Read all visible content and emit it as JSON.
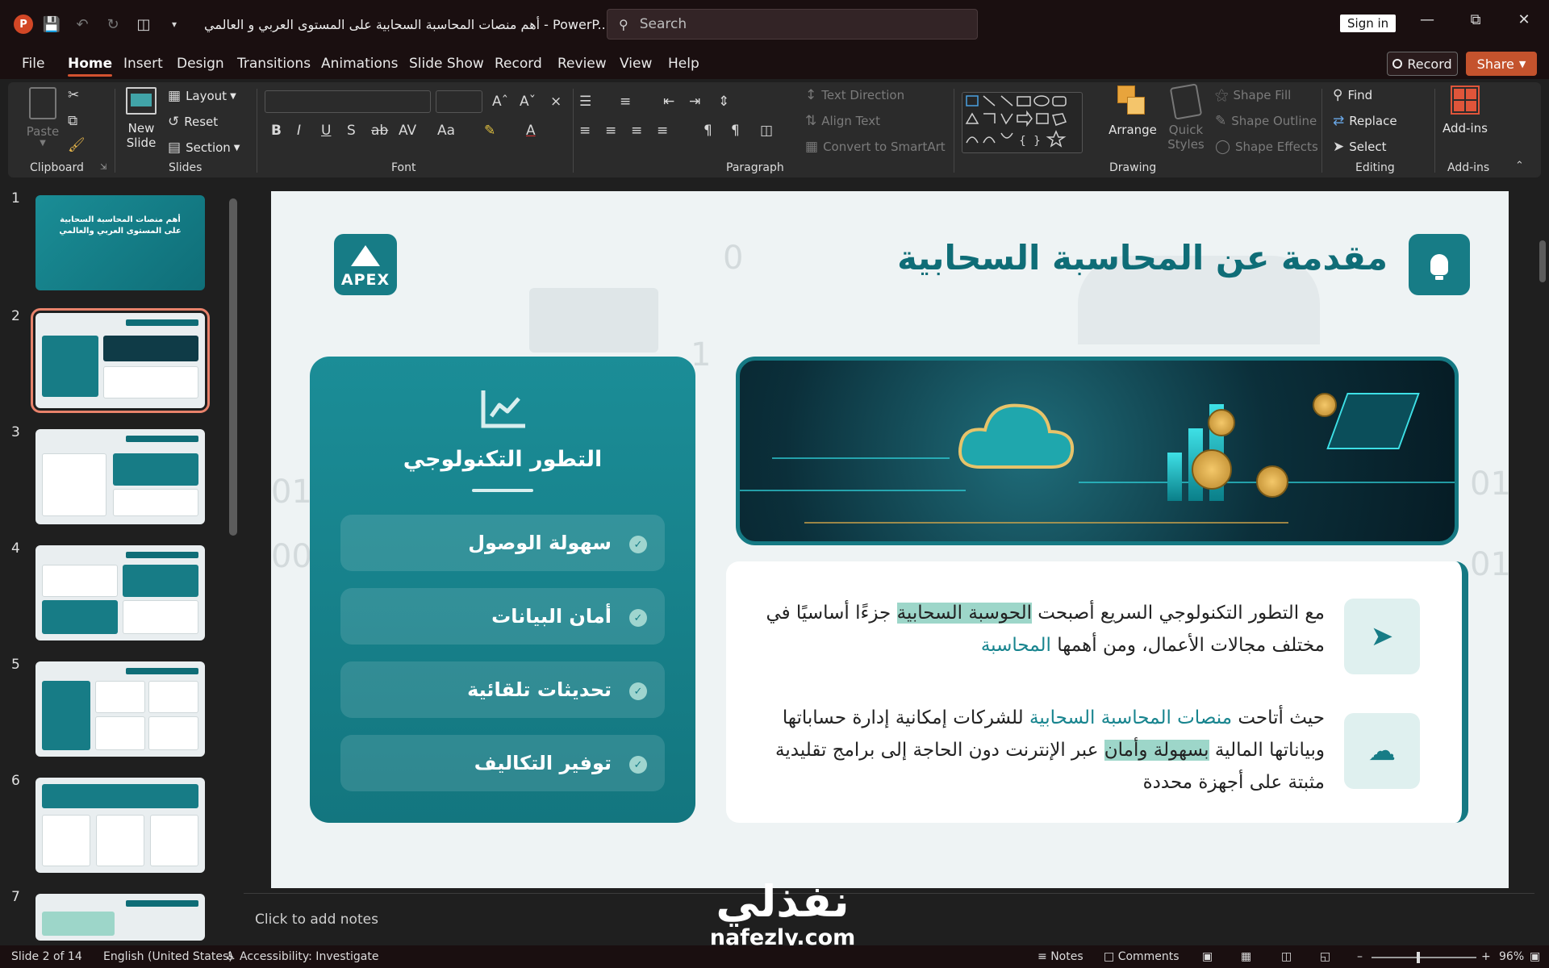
{
  "titlebar": {
    "app_icon_letter": "P",
    "document_title": "أهم منصات المحاسبة السحابية على المستوى العربي و العالمي  -  PowerP...",
    "search_placeholder": "Search",
    "sign_in_label": "Sign in"
  },
  "menu": {
    "tabs": [
      "File",
      "Home",
      "Insert",
      "Design",
      "Transitions",
      "Animations",
      "Slide Show",
      "Record",
      "Review",
      "View",
      "Help"
    ],
    "active_tab": "Home",
    "record_label": "Record",
    "share_label": "Share"
  },
  "ribbon": {
    "clipboard": {
      "paste": "Paste",
      "group": "Clipboard"
    },
    "slides": {
      "new_slide": "New Slide",
      "layout": "Layout",
      "reset": "Reset",
      "section": "Section",
      "group": "Slides"
    },
    "font": {
      "group": "Font"
    },
    "paragraph": {
      "group": "Paragraph",
      "text_direction": "Text Direction",
      "align_text": "Align Text",
      "convert_smartart": "Convert to SmartArt"
    },
    "drawing": {
      "group": "Drawing",
      "arrange": "Arrange",
      "quick_styles": "Quick Styles",
      "shape_fill": "Shape Fill",
      "shape_outline": "Shape Outline",
      "shape_effects": "Shape Effects"
    },
    "editing": {
      "group": "Editing",
      "find": "Find",
      "replace": "Replace",
      "select": "Select"
    },
    "addins": {
      "group": "Add-ins",
      "label": "Add-ins"
    }
  },
  "thumbnails": {
    "numbers": [
      "1",
      "2",
      "3",
      "4",
      "5",
      "6",
      "7"
    ],
    "selected": 2,
    "slide1_title": "أهم منصات المحاسبة السحابية على المستوى العربي والعالمي"
  },
  "slide": {
    "logo_text": "APEX",
    "title": "مقدمة عن المحاسبة السحابية",
    "panel_title": "التطور التكنولوجي",
    "features": [
      "سهولة الوصول",
      "أمان البيانات",
      "تحديثات تلقائية",
      "توفير التكاليف"
    ],
    "para1": {
      "a": "مع التطور التكنولوجي السريع أصبحت ",
      "b": "الحوسبة السحابية",
      "c": " جزءًا أساسيًا في مختلف مجالات الأعمال، ومن أهمها ",
      "d": "المحاسبة"
    },
    "para2": {
      "a": "حيث أتاحت ",
      "b": "منصات المحاسبة السحابية",
      "c": " للشركات إمكانية إدارة حساباتها وبياناتها المالية ",
      "d": "بسهولة وأمان",
      "e": " عبر الإنترنت دون الحاجة إلى برامج تقليدية مثبتة على أجهزة محددة"
    }
  },
  "notes_placeholder": "Click to add notes",
  "watermark": {
    "arabic": "نفذلي",
    "latin": "nafezly.com"
  },
  "statusbar": {
    "slide_info": "Slide 2 of 14",
    "language": "English (United States)",
    "accessibility": "Accessibility: Investigate",
    "notes": "Notes",
    "comments": "Comments",
    "zoom": "96%"
  },
  "colors": {
    "accent": "#d35230",
    "slide_teal": "#177c86",
    "highlight": "#9dd6c9"
  }
}
